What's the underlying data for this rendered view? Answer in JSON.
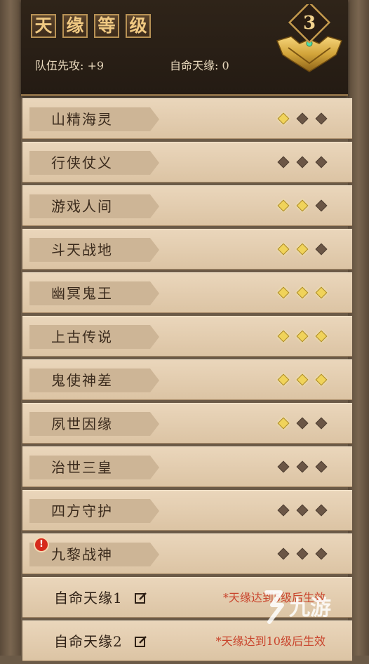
{
  "header": {
    "title_chars": [
      "天",
      "缘",
      "等",
      "级"
    ],
    "team_first_strike": "队伍先攻: +9",
    "custom_fate": "自命天缘: 0",
    "level": "3"
  },
  "rows": [
    {
      "label": "山精海灵",
      "stars": [
        true,
        false,
        false
      ]
    },
    {
      "label": "行侠仗义",
      "stars": [
        false,
        false,
        false
      ]
    },
    {
      "label": "游戏人间",
      "stars": [
        true,
        true,
        false
      ]
    },
    {
      "label": "斗天战地",
      "stars": [
        true,
        true,
        false
      ]
    },
    {
      "label": "幽冥鬼王",
      "stars": [
        true,
        true,
        true
      ]
    },
    {
      "label": "上古传说",
      "stars": [
        true,
        true,
        true
      ]
    },
    {
      "label": "鬼使神差",
      "stars": [
        true,
        true,
        true
      ]
    },
    {
      "label": "夙世因缘",
      "stars": [
        true,
        false,
        false
      ]
    },
    {
      "label": "治世三皇",
      "stars": [
        false,
        false,
        false
      ]
    },
    {
      "label": "四方守护",
      "stars": [
        false,
        false,
        false
      ]
    },
    {
      "label": "九黎战神",
      "stars": [
        false,
        false,
        false
      ],
      "alert": "!"
    }
  ],
  "custom": [
    {
      "label": "自命天缘1",
      "requirement": "*天缘达到5级后生效"
    },
    {
      "label": "自命天缘2",
      "requirement": "*天缘达到10级后生效"
    }
  ],
  "watermark": {
    "text": "九游"
  },
  "colors": {
    "lit": "#f0d35a",
    "unlit": "#6b5646",
    "requirement": "#c9442c",
    "title": "#f0c982"
  }
}
